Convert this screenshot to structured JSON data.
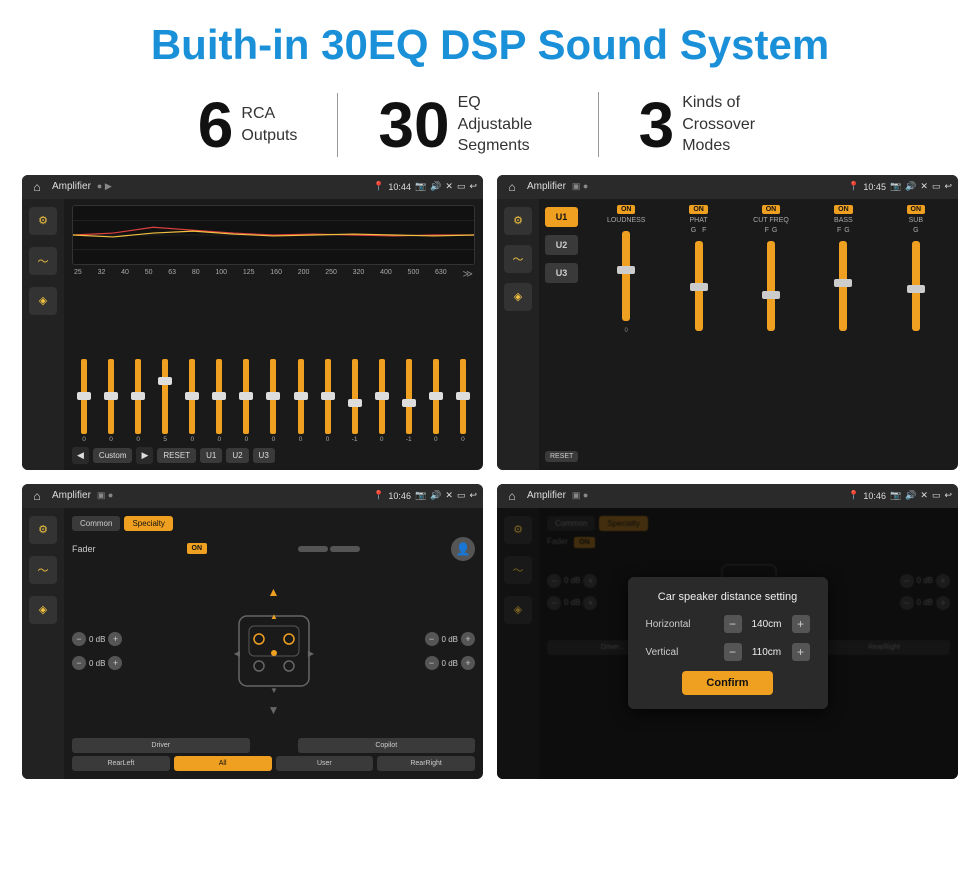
{
  "page": {
    "title": "Buith-in 30EQ DSP Sound System"
  },
  "stats": [
    {
      "number": "6",
      "label": "RCA\nOutputs"
    },
    {
      "number": "30",
      "label": "EQ Adjustable\nSegments"
    },
    {
      "number": "3",
      "label": "Kinds of\nCrossover Modes"
    }
  ],
  "screens": [
    {
      "id": "screen1",
      "title": "Amplifier",
      "time": "10:44",
      "type": "eq"
    },
    {
      "id": "screen2",
      "title": "Amplifier",
      "time": "10:45",
      "type": "crossover"
    },
    {
      "id": "screen3",
      "title": "Amplifier",
      "time": "10:46",
      "type": "fader"
    },
    {
      "id": "screen4",
      "title": "Amplifier",
      "time": "10:46",
      "type": "dialog"
    }
  ],
  "eq": {
    "frequencies": [
      "25",
      "32",
      "40",
      "50",
      "63",
      "80",
      "100",
      "125",
      "160",
      "200",
      "250",
      "320",
      "400",
      "500",
      "630"
    ],
    "values": [
      "0",
      "0",
      "0",
      "5",
      "0",
      "0",
      "0",
      "0",
      "0",
      "0",
      "-1",
      "0",
      "-1",
      "0",
      "0"
    ],
    "presets": [
      "Custom",
      "RESET",
      "U1",
      "U2",
      "U3"
    ]
  },
  "crossover": {
    "units": [
      "U1",
      "U2",
      "U3"
    ],
    "channels": [
      "LOUDNESS",
      "PHAT",
      "CUT FREQ",
      "BASS",
      "SUB"
    ]
  },
  "fader": {
    "tabs": [
      "Common",
      "Specialty"
    ],
    "label": "Fader",
    "dbValues": [
      "0 dB",
      "0 dB",
      "0 dB",
      "0 dB"
    ],
    "bottomBtns": [
      "Driver",
      "All",
      "RearLeft",
      "User",
      "RearRight",
      "Copilot"
    ]
  },
  "dialog": {
    "title": "Car speaker distance setting",
    "fields": [
      {
        "label": "Horizontal",
        "value": "140cm"
      },
      {
        "label": "Vertical",
        "value": "110cm"
      }
    ],
    "confirm": "Confirm",
    "bottomBtns": [
      "RearLeft",
      "All",
      "User",
      "RearRight"
    ]
  }
}
